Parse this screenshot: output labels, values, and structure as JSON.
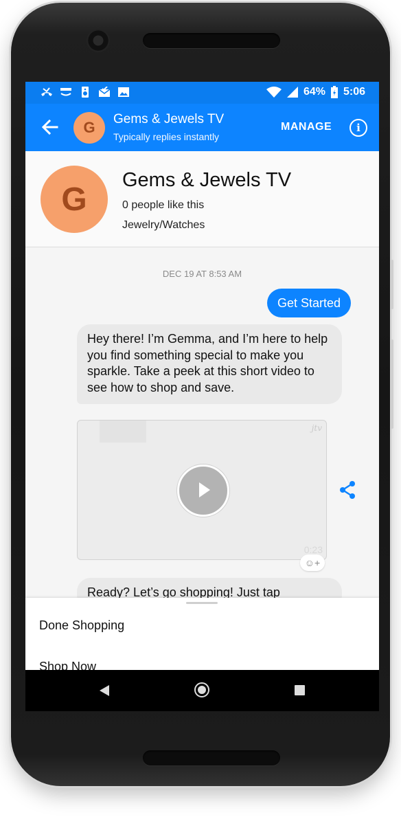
{
  "statusbar": {
    "battery": "64%",
    "time": "5:06",
    "icons": [
      "missed-call-icon",
      "amazon-icon",
      "speaker-icon",
      "mail-check-icon",
      "image-icon",
      "wifi-icon",
      "signal-icon",
      "battery-icon"
    ]
  },
  "appbar": {
    "avatar_letter": "G",
    "title": "Gems & Jewels TV",
    "subtitle": "Typically replies instantly",
    "manage_label": "MANAGE",
    "info_label": "i",
    "color": "#0d84ff"
  },
  "page": {
    "avatar_letter": "G",
    "name": "Gems & Jewels TV",
    "likes": "0 people like this",
    "category": "Jewelry/Watches",
    "avatar_color": "#f6a06b"
  },
  "chat": {
    "timestamp": "DEC 19 AT 8:53 AM",
    "sent_message": "Get Started",
    "received_message": "Hey there! I’m Gemma, and I’m here to help you find something special to make you sparkle. Take a peek at this short video to see how to shop and save.",
    "video": {
      "logo": "jtv",
      "duration": "0:23"
    },
    "react_label": "☺+",
    "received_message_2": "Ready? Let’s go shopping! Just tap"
  },
  "quick_replies": [
    "Done Shopping",
    "Shop Now"
  ]
}
